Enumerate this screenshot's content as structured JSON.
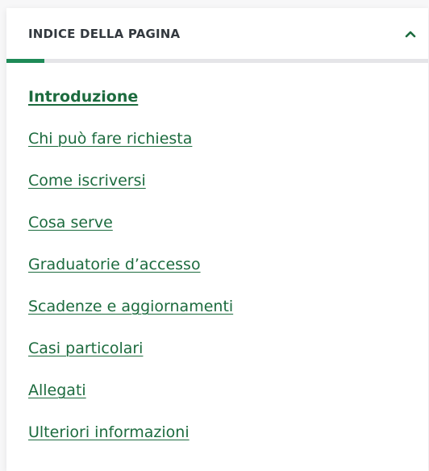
{
  "toc": {
    "title": "INDICE DELLA PAGINA",
    "progress_fraction": 0.09,
    "items": [
      {
        "label": "Introduzione",
        "active": true
      },
      {
        "label": "Chi può fare richiesta",
        "active": false
      },
      {
        "label": "Come iscriversi",
        "active": false
      },
      {
        "label": "Cosa serve",
        "active": false
      },
      {
        "label": "Graduatorie d’accesso",
        "active": false
      },
      {
        "label": "Scadenze e aggiornamenti",
        "active": false
      },
      {
        "label": "Casi particolari",
        "active": false
      },
      {
        "label": "Allegati",
        "active": false
      },
      {
        "label": "Ulteriori informazioni",
        "active": false
      }
    ]
  },
  "colors": {
    "accent": "#1e8a57",
    "link": "#1c6b3e",
    "header_text": "#33393f",
    "track": "#e5e5e8"
  },
  "icons": {
    "toggle": "chevron-up-icon"
  }
}
